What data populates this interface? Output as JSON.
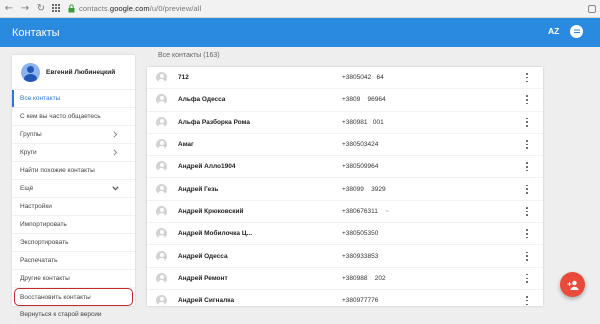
{
  "browser": {
    "url_prefix": "contacts.",
    "url_domain": "google.com",
    "url_path": "/u/0/preview/all"
  },
  "header": {
    "title": "Контакты",
    "sort_label": "AZ",
    "accent_color": "#2a8ae0"
  },
  "sidebar": {
    "profile_name": "Евгений Любинецкий",
    "items": [
      {
        "label": "Все контакты",
        "active": true
      },
      {
        "label": "С кем вы часто общаетесь"
      },
      {
        "label": "Группы",
        "chevron": "chevron-right"
      },
      {
        "label": "Круги",
        "chevron": "chevron-right"
      },
      {
        "label": "Найти похожие контакты"
      },
      {
        "label": "Ещё",
        "chevron": "chevron-down"
      },
      {
        "label": "Настройки"
      },
      {
        "label": "Импортировать"
      },
      {
        "label": "Экспортировать"
      },
      {
        "label": "Распечатать"
      },
      {
        "label": "Другие контакты"
      },
      {
        "label": "Восстановить контакты",
        "highlighted": true
      },
      {
        "label": "Вернуться к старой версии"
      }
    ]
  },
  "main": {
    "heading": "Все контакты (163)",
    "contacts": [
      {
        "name": "712",
        "phone": "+3805042   64",
        "extra": ""
      },
      {
        "name": "Альфа Одесса",
        "phone": "+3809    96964",
        "extra": ""
      },
      {
        "name": "Альфа Разборка Рома",
        "phone": "+380981   001",
        "extra": ""
      },
      {
        "name": "Амаг",
        "phone": "+380503424",
        "extra": ""
      },
      {
        "name": "Андрей Алло1904",
        "phone": "+380509964",
        "extra": ""
      },
      {
        "name": "Андрей Гезь",
        "phone": "+38099    3929",
        "extra": ""
      },
      {
        "name": "Андрей Крюковский",
        "phone": "+380676311",
        "extra": "~"
      },
      {
        "name": "Андрей Мобилочка Ц...",
        "phone": "+380505350",
        "extra": ""
      },
      {
        "name": "Андрей Одесса",
        "phone": "+380933853",
        "extra": ""
      },
      {
        "name": "Андрей Ремонт",
        "phone": "+380988    202",
        "extra": ""
      },
      {
        "name": "Андрей Сигналка",
        "phone": "+380977776",
        "extra": ""
      }
    ]
  },
  "fab": {
    "icon": "add-person-icon",
    "color": "#e94a3a"
  }
}
